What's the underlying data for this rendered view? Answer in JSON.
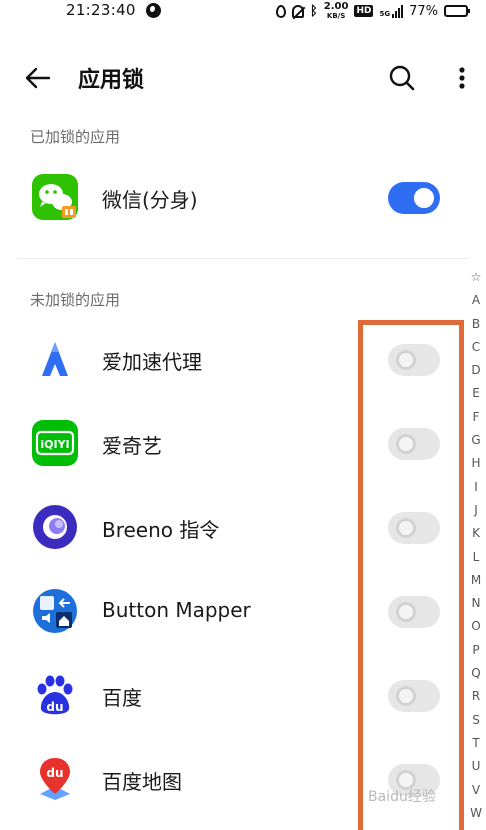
{
  "status_bar": {
    "time": "21:23:40",
    "net_speed_value": "2.00",
    "net_speed_unit": "KB/S",
    "hd_label": "HD",
    "signal_label": "5G",
    "battery_percent": "77%",
    "battery_level": 0.77
  },
  "header": {
    "title": "应用锁"
  },
  "locked_section": {
    "title": "已加锁的应用",
    "apps": [
      {
        "name": "微信(分身)",
        "icon": "wechat-clone-icon",
        "locked": true
      }
    ]
  },
  "unlocked_section": {
    "title": "未加锁的应用",
    "apps": [
      {
        "name": "爱加速代理",
        "icon": "aijiasu-icon",
        "locked": false
      },
      {
        "name": "爱奇艺",
        "icon": "iqiyi-icon",
        "locked": false
      },
      {
        "name": "Breeno 指令",
        "icon": "breeno-icon",
        "locked": false
      },
      {
        "name": "Button Mapper",
        "icon": "button-mapper-icon",
        "locked": false
      },
      {
        "name": "百度",
        "icon": "baidu-icon",
        "locked": false
      },
      {
        "name": "百度地图",
        "icon": "baidu-map-icon",
        "locked": false
      }
    ]
  },
  "index_bar": [
    "☆",
    "A",
    "B",
    "C",
    "D",
    "E",
    "F",
    "G",
    "H",
    "I",
    "J",
    "K",
    "L",
    "M",
    "N",
    "O",
    "P",
    "Q",
    "R",
    "S",
    "T",
    "U",
    "V",
    "W"
  ],
  "icon_texts": {
    "iqiyi": "iQIYI",
    "baidu": "du",
    "baidu_map": "du"
  },
  "watermark": "Baidu经验",
  "colors": {
    "accent": "#2f6ef3",
    "highlight": "#e06a3a",
    "wechat_green": "#2dc100",
    "iqiyi_green": "#00be06",
    "baidu_blue": "#2932e1"
  }
}
